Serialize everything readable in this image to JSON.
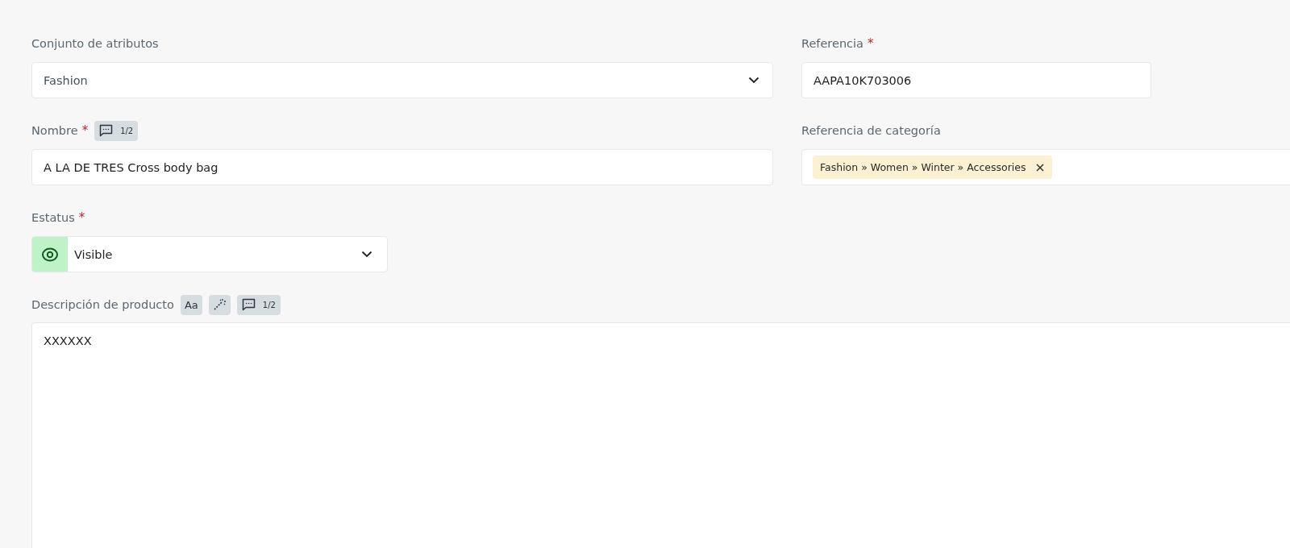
{
  "attribute_set": {
    "label": "Conjunto de atributos",
    "value": "Fashion"
  },
  "reference": {
    "label": "Referencia",
    "required_mark": "*",
    "value": "AAPA10K703006"
  },
  "name": {
    "label": "Nombre",
    "required_mark": "*",
    "translation_badge": "1/2",
    "value": "A LA DE TRES Cross body bag"
  },
  "category_reference": {
    "label": "Referencia de categoría",
    "tags": [
      {
        "label": "Fashion » Women » Winter » Accessories"
      }
    ]
  },
  "status": {
    "label": "Estatus",
    "required_mark": "*",
    "value": "Visible",
    "visible": true
  },
  "description": {
    "label": "Descripción de producto",
    "font_button": "Aa",
    "translation_badge": "1/2",
    "value": "XXXXXX"
  }
}
